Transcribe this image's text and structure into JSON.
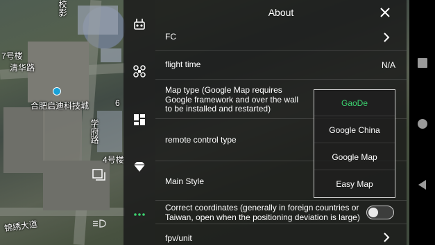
{
  "map": {
    "labels": {
      "building_7": "7号楼",
      "qinghua_road": "清华路",
      "company": "合肥启迪科技城",
      "xuefu_road": "学府路",
      "building_4": "4号楼",
      "jinxiu_road": "锦绣大道",
      "sign_top": "校影",
      "num_6": "6"
    }
  },
  "rail": {
    "items": [
      {
        "icon": "remote-controller-icon"
      },
      {
        "icon": "drone-icon"
      },
      {
        "icon": "dashboard-icon"
      },
      {
        "icon": "diamond-icon"
      },
      {
        "icon": "more-icon",
        "active": true
      }
    ]
  },
  "header": {
    "title": "About",
    "close_icon": "close-icon"
  },
  "rows": {
    "fc": {
      "label": "FC"
    },
    "flight_time": {
      "label": "flight time",
      "value": "N/A"
    },
    "map_type": {
      "label_line1": "Map type (Google Map requires",
      "label_line2": "Google framework and over the wall",
      "label_line3": "to be installed and restarted)"
    },
    "remote_control": {
      "label": "remote control type"
    },
    "main_style": {
      "label": "Main Style"
    },
    "correct_coords": {
      "label_line1": "Correct coordinates (generally in foreign countries or",
      "label_line2": "Taiwan, open when the positioning deviation is large)",
      "enabled": false
    },
    "fpv_unit": {
      "label": "fpv/unit"
    }
  },
  "dropdown": {
    "options": [
      "GaoDe",
      "Google China",
      "Google Map",
      "Easy Map"
    ],
    "selected": "GaoDe"
  },
  "colors": {
    "accent": "#3bd16f"
  },
  "navbar": {
    "buttons": [
      "recents-square-icon",
      "home-circle-icon",
      "back-triangle-icon"
    ]
  }
}
